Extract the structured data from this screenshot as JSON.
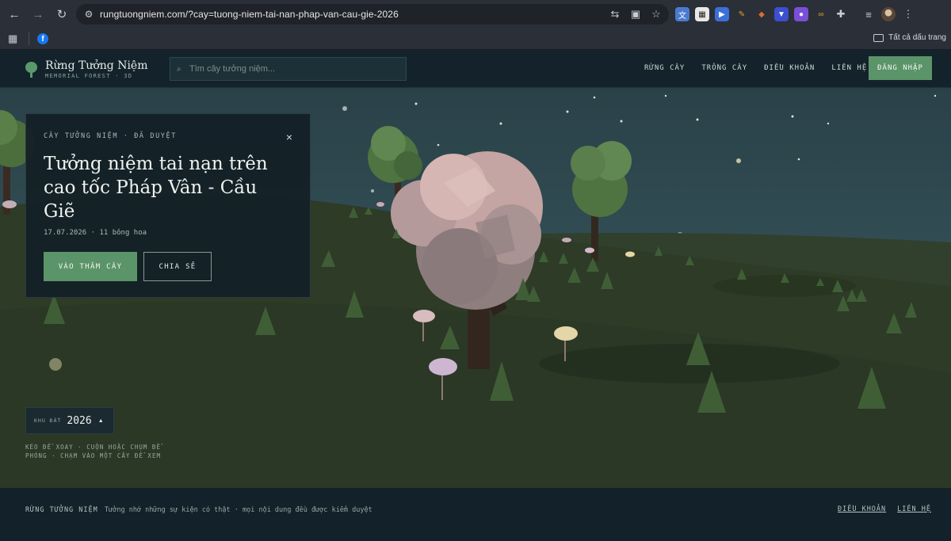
{
  "browser": {
    "url": "rungtuongniem.com/?cay=tuong-niem-tai-nan-phap-van-cau-gie-2026",
    "bookmark_folder": "Tất cả dấu trang"
  },
  "header": {
    "logo_title": "Rừng Tưởng Niệm",
    "logo_subtitle": "MEMORIAL FOREST · 3D",
    "search_placeholder": "Tìm cây tưởng niệm...",
    "nav": [
      "RỪNG CÂY",
      "TRỒNG CÂY",
      "ĐIỀU KHOẢN",
      "LIÊN HỆ"
    ],
    "login_label": "ĐĂNG NHẬP"
  },
  "card": {
    "eyebrow": "CÂY TƯỞNG NIỆM · ĐÃ DUYỆT",
    "close": "×",
    "title": "Tưởng niệm tai nạn trên cao tốc Pháp Vân - Cầu Giẽ",
    "meta": "17.07.2026 · 11 bông hoa",
    "visit_label": "VÀO THĂM CÂY",
    "share_label": "CHIA SẺ"
  },
  "plot": {
    "label": "KHU ĐẤT",
    "year": "2026",
    "arrow": "▲"
  },
  "hint": "KÉO ĐỂ XOAY · CUỘN HOẶC CHỤM ĐỂ PHÓNG · CHẠM VÀO MỘT CÂY ĐỂ XEM",
  "footer": {
    "brand": "RỪNG TƯỞNG NIỆM",
    "tagline": "Tưởng nhớ những sự kiện có thật · mọi nội dung đều được kiểm duyệt",
    "links": [
      "ĐIỀU KHOẢN",
      "LIÊN HỆ"
    ]
  },
  "colors": {
    "accent": "#5b9468",
    "header_bg": "#14232b",
    "card_bg": "#142026",
    "sky": "#355359",
    "ground": "#2c3b27",
    "blossom": "#c9a9a7"
  }
}
